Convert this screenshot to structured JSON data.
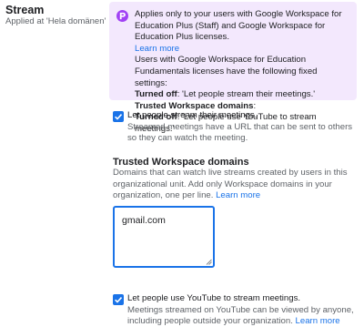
{
  "section": {
    "title": "Stream",
    "applied_at": "Applied at 'Hela domänen'"
  },
  "notice": {
    "line1": "Applies only to your users with Google Workspace for Education Plus (Staff) and Google Workspace for Education Plus licenses.",
    "learn_more": "Learn more",
    "line2": "Users with Google Workspace for Education Fundamentals licenses have the following fixed settings:",
    "turned_off_label": "Turned off",
    "turned_off_value_1": ": 'Let people stream their meetings.'",
    "trusted_label": "Trusted Workspace domains",
    "trusted_colon": ":",
    "turned_off_value_2": ": 'Let people use YouTube to stream meetings.'",
    "icon": "premium-badge-icon",
    "color": "#f3e8fd"
  },
  "stream_setting": {
    "checked": true,
    "label": "Let people stream their meetings.",
    "description": "Streamed meetings have a URL that can be sent to others so they can watch the meeting."
  },
  "trusted_domains": {
    "title": "Trusted Workspace domains",
    "description": "Domains that can watch live streams created by users in this organizational unit. Add only Workspace domains in your organization, one per line.",
    "learn_more": "Learn more",
    "value": "gmail.com"
  },
  "youtube_setting": {
    "checked": true,
    "label": "Let people use YouTube to stream meetings.",
    "description": "Meetings streamed on YouTube can be viewed by anyone, including people outside your organization.",
    "learn_more": "Learn more"
  },
  "colors": {
    "accent": "#1a73e8",
    "badge": "#a142f4"
  }
}
